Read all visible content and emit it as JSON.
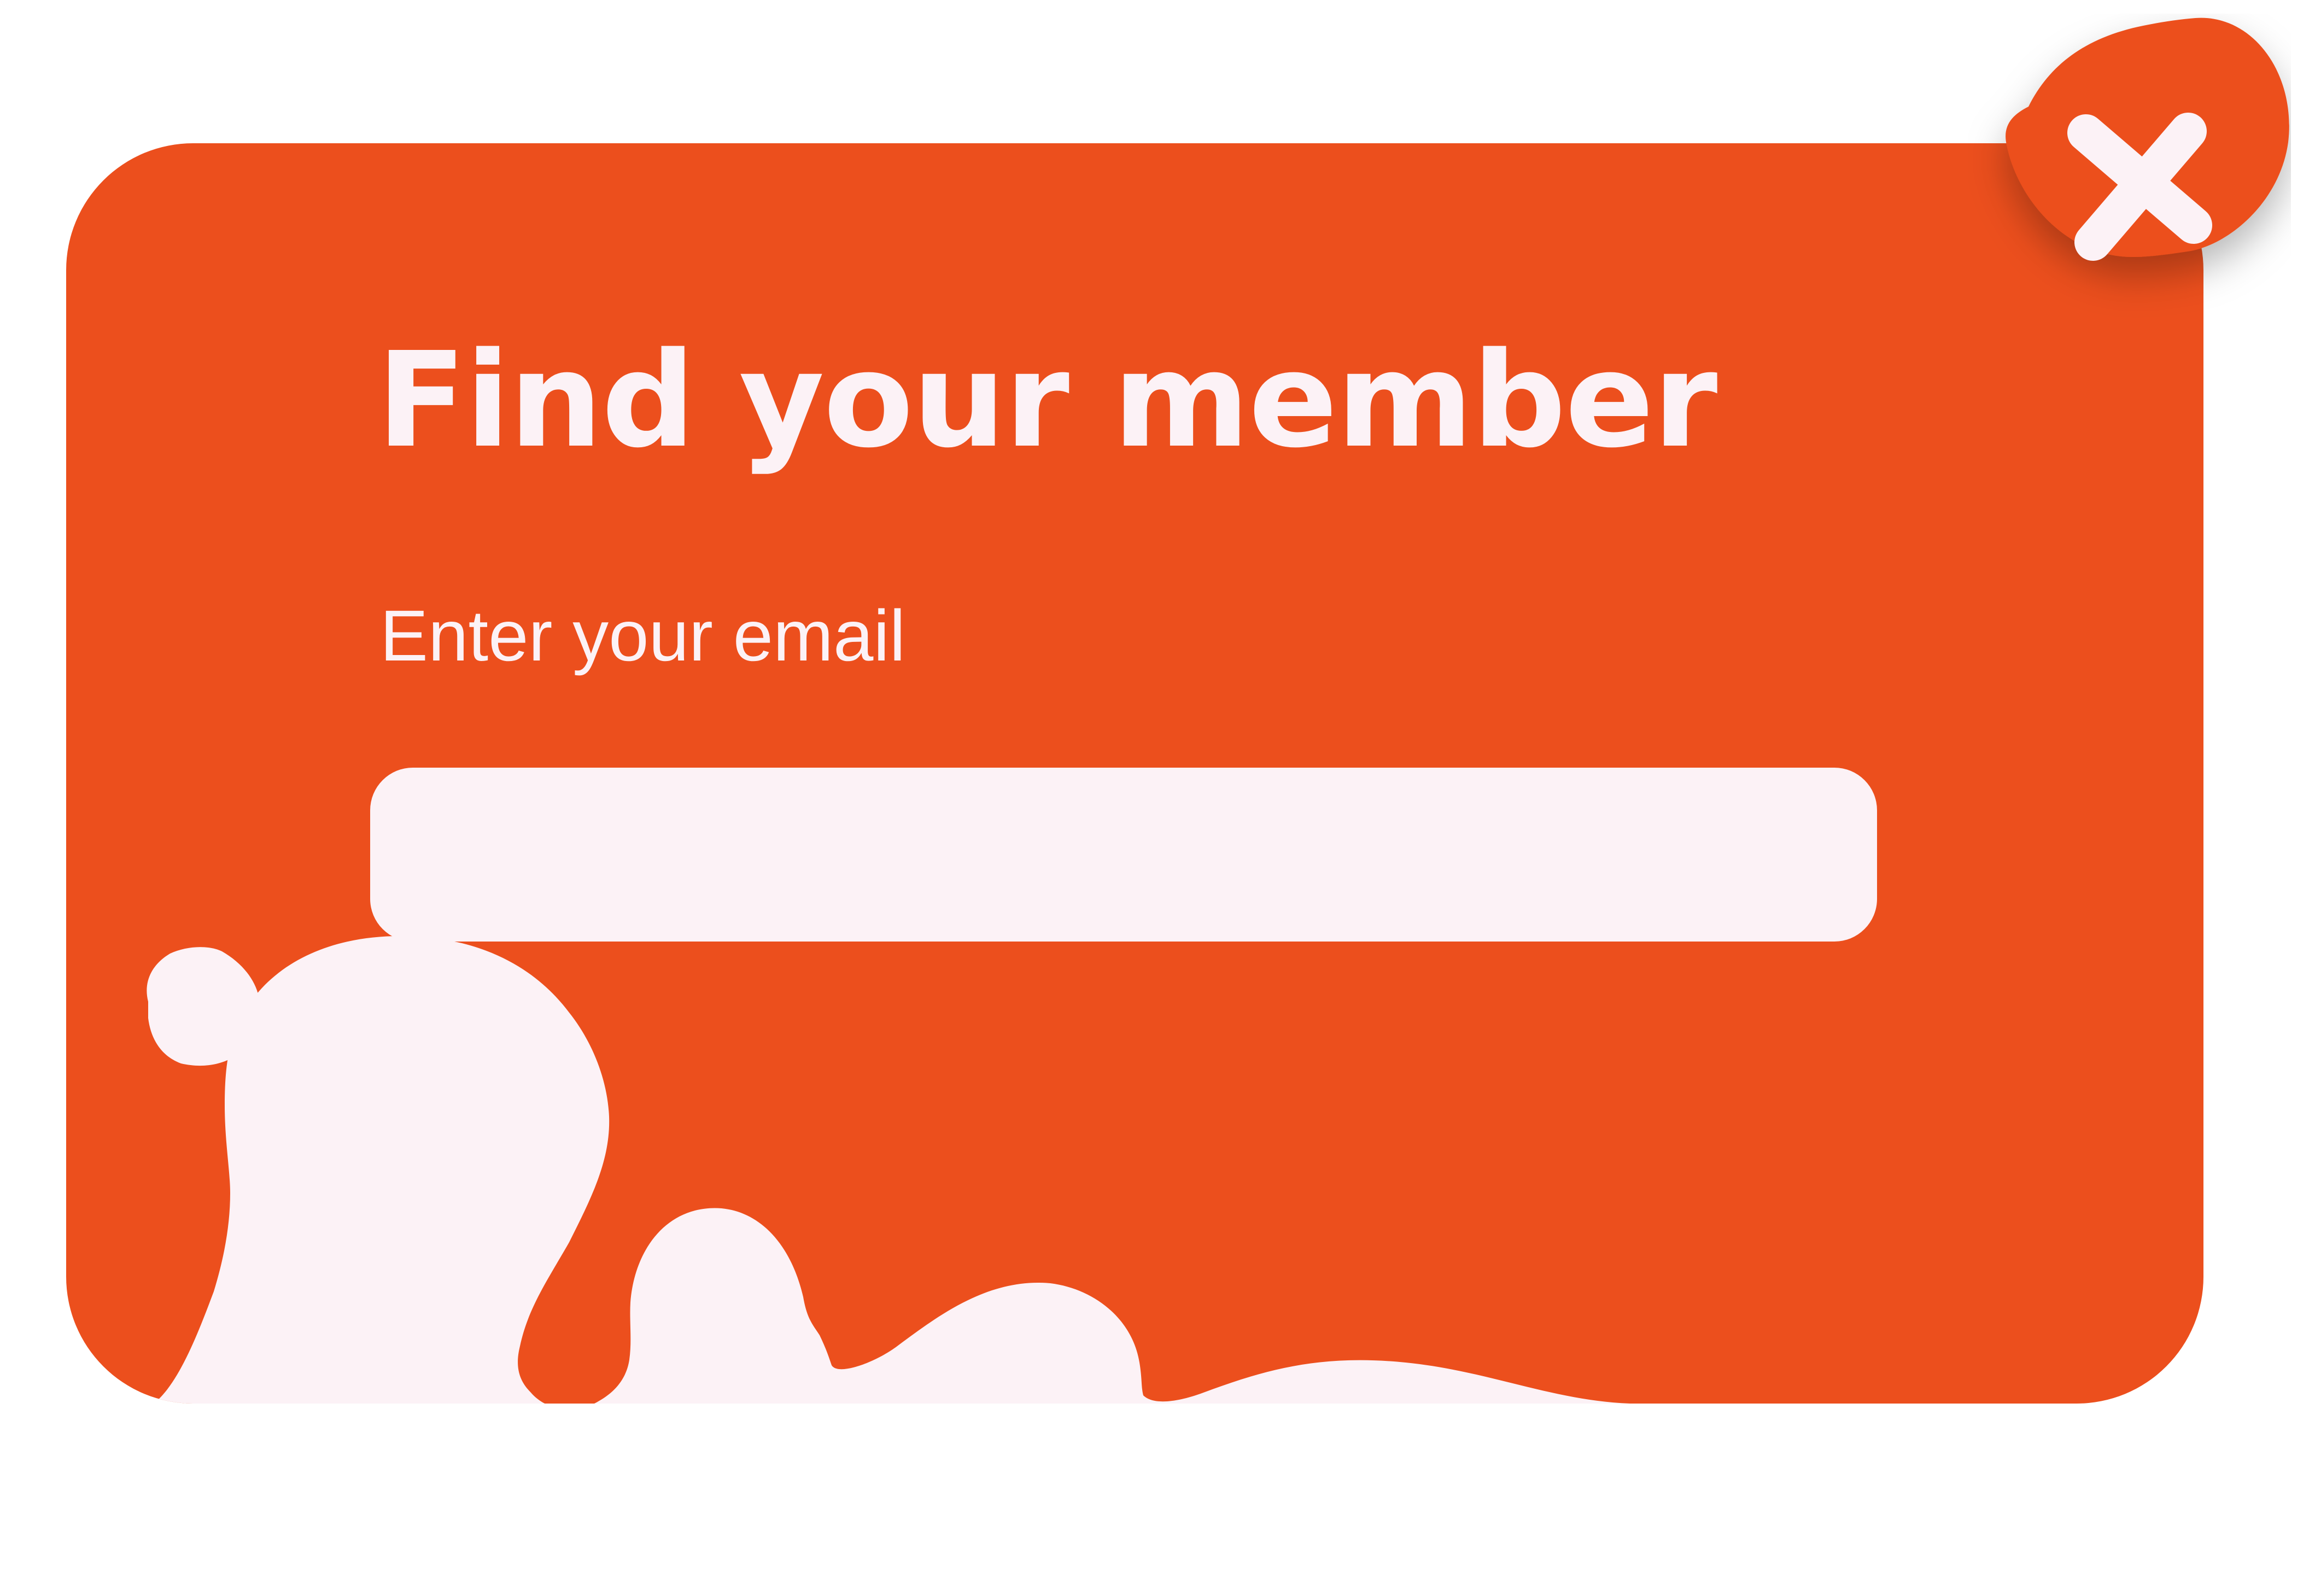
{
  "modal": {
    "title": "Find your member",
    "email_label": "Enter your email",
    "email_value": "",
    "email_placeholder": "",
    "close_icon": "close-icon"
  },
  "colors": {
    "accent": "#EC4F1D",
    "foreground": "#FCF2F6",
    "background": "#FFFFFF"
  }
}
